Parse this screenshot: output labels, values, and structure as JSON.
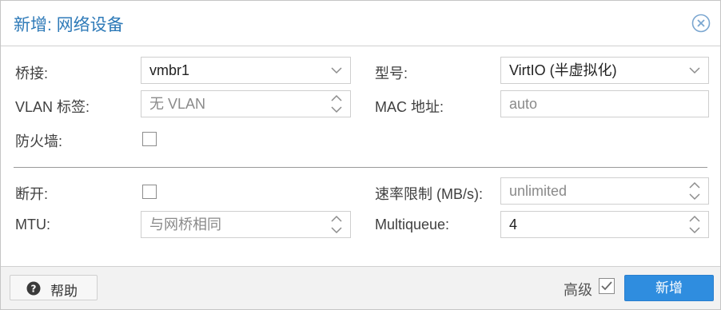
{
  "dialog": {
    "title": "新增: 网络设备",
    "close_icon": "close-circle-icon"
  },
  "form": {
    "bridge": {
      "label": "桥接:",
      "value": "vmbr1"
    },
    "vlan_tag": {
      "label": "VLAN 标签:",
      "placeholder": "无 VLAN"
    },
    "firewall": {
      "label": "防火墙:",
      "checked": false
    },
    "model": {
      "label": "型号:",
      "value": "VirtIO (半虚拟化)"
    },
    "mac_address": {
      "label": "MAC 地址:",
      "value": "auto"
    },
    "disconnect": {
      "label": "断开:",
      "checked": false
    },
    "mtu": {
      "label": "MTU:",
      "placeholder": "与网桥相同"
    },
    "rate_limit": {
      "label": "速率限制 (MB/s):",
      "placeholder": "unlimited"
    },
    "multiqueue": {
      "label": "Multiqueue:",
      "value": "4"
    }
  },
  "footer": {
    "help_label": "帮助",
    "advanced_label": "高级",
    "advanced_checked": true,
    "add_label": "新增"
  },
  "colors": {
    "title": "#2e7ab8",
    "primary_button": "#2f8ddf"
  }
}
